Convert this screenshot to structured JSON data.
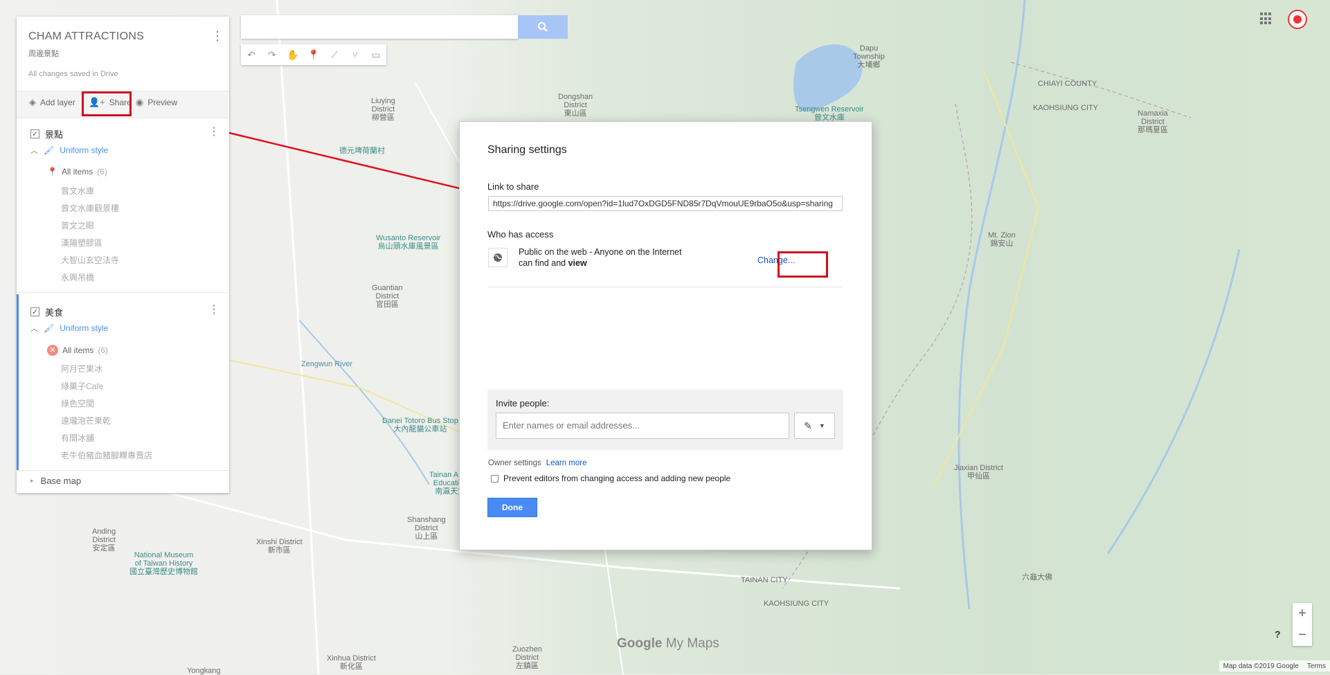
{
  "map": {
    "labels": [
      {
        "id": "l1",
        "text": "Dapu\nTownship\n大埔鄉",
        "cls": ""
      },
      {
        "id": "l2",
        "text": "CHIAYI COUNTY",
        "cls": ""
      },
      {
        "id": "l3",
        "text": "KAOHSIUNG CITY",
        "cls": ""
      },
      {
        "id": "l4",
        "text": "Namaxia\nDistrict\n那瑪夏區",
        "cls": ""
      },
      {
        "id": "l5",
        "text": "Dongshan\nDistrict\n東山區",
        "cls": ""
      },
      {
        "id": "l6",
        "text": "Liuying\nDistrict\n柳營區",
        "cls": ""
      },
      {
        "id": "l7",
        "text": "Tsengwen Reservoir\n曾文水庫",
        "cls": "tealabel"
      },
      {
        "id": "l8",
        "text": "德元埤荷蘭村",
        "cls": "tealabel"
      },
      {
        "id": "l9",
        "text": "Wusanto Reservoir\n烏山頭水庫風景區",
        "cls": "tealabel"
      },
      {
        "id": "l10",
        "text": "Mt. Zion\n錫安山",
        "cls": ""
      },
      {
        "id": "l11",
        "text": "Guantian\nDistrict\n官田區",
        "cls": ""
      },
      {
        "id": "l12",
        "text": "Danei Totoro Bus Stop\n大內龍貓公車站",
        "cls": "tealabel"
      },
      {
        "id": "l13",
        "text": "Jiaxian District\n甲仙區",
        "cls": ""
      },
      {
        "id": "l14",
        "text": "Tainan Astro\nEducation\n南瀛天文",
        "cls": "tealabel"
      },
      {
        "id": "l15",
        "text": "Anding\nDistrict\n安定區",
        "cls": ""
      },
      {
        "id": "l16",
        "text": "Shanshang\nDistrict\n山上區",
        "cls": ""
      },
      {
        "id": "l17",
        "text": "Xinshi District\n新市區",
        "cls": ""
      },
      {
        "id": "l18",
        "text": "National Museum\nof Taiwan History\n國立臺灣歷史博物館",
        "cls": "tealabel"
      },
      {
        "id": "l19",
        "text": "六龜大佛",
        "cls": ""
      },
      {
        "id": "l20",
        "text": "Zuozhen\nDistrict\n左鎮區",
        "cls": ""
      },
      {
        "id": "l21",
        "text": "Xinhua District\n新化區",
        "cls": ""
      },
      {
        "id": "l22",
        "text": "TAINAN CITY",
        "cls": ""
      },
      {
        "id": "l23",
        "text": "KAOHSIUNG CITY",
        "cls": ""
      },
      {
        "id": "l24",
        "text": "Zengwun River",
        "cls": "bluelabel"
      },
      {
        "id": "l25",
        "text": "Yongkang",
        "cls": ""
      }
    ]
  },
  "panel": {
    "title": "CHAM ATTRACTIONS",
    "subtitle": "周邊景點",
    "saved_status": "All changes saved in Drive",
    "toolbar": {
      "add_layer": "Add layer",
      "share": "Share",
      "preview": "Preview"
    },
    "layers": [
      {
        "name": "景點",
        "style": "Uniform style",
        "all_items": "All items",
        "count": "(6)",
        "items": [
          "曾文水庫",
          "曾文水庫觀景樓",
          "曾文之眼",
          "漢陽塑膠區",
          "大智山玄空法寺",
          "永興吊橋"
        ]
      },
      {
        "name": "美食",
        "style": "Uniform style",
        "all_items": "All items",
        "count": "(6)",
        "items": [
          "阿月芒果冰",
          "綠菓子Cafe",
          "綠色空間",
          "遠瓏泡芒果乾",
          "有間冰舖",
          "老牛伯豬血豬腳粿專賣店"
        ]
      }
    ],
    "base_map": "Base map"
  },
  "dialog": {
    "title": "Sharing settings",
    "link_label": "Link to share",
    "link_value": "https://drive.google.com/open?id=1lud7OxDGD5FND85r7DqVmouUE9rbaO5o&usp=sharing",
    "access_label": "Who has access",
    "access_line1": "Public on the web - Anyone on the Internet",
    "access_line2_prefix": "can find and ",
    "access_line2_bold": "view",
    "change": "Change...",
    "invite_label": "Invite people:",
    "invite_placeholder": "Enter names or email addresses...",
    "owner_settings": "Owner settings",
    "learn_more": "Learn more",
    "prevent_label": "Prevent editors from changing access and adding new people",
    "done": "Done"
  },
  "brand": {
    "google": "Google",
    "mymaps": "My Maps"
  },
  "footer": {
    "map_data": "Map data ©2019 Google",
    "terms": "Terms"
  },
  "zoom": {
    "in": "+",
    "out": "−"
  },
  "help": "?",
  "annotation_color": "#d01020",
  "arrow_color": "#e01020"
}
